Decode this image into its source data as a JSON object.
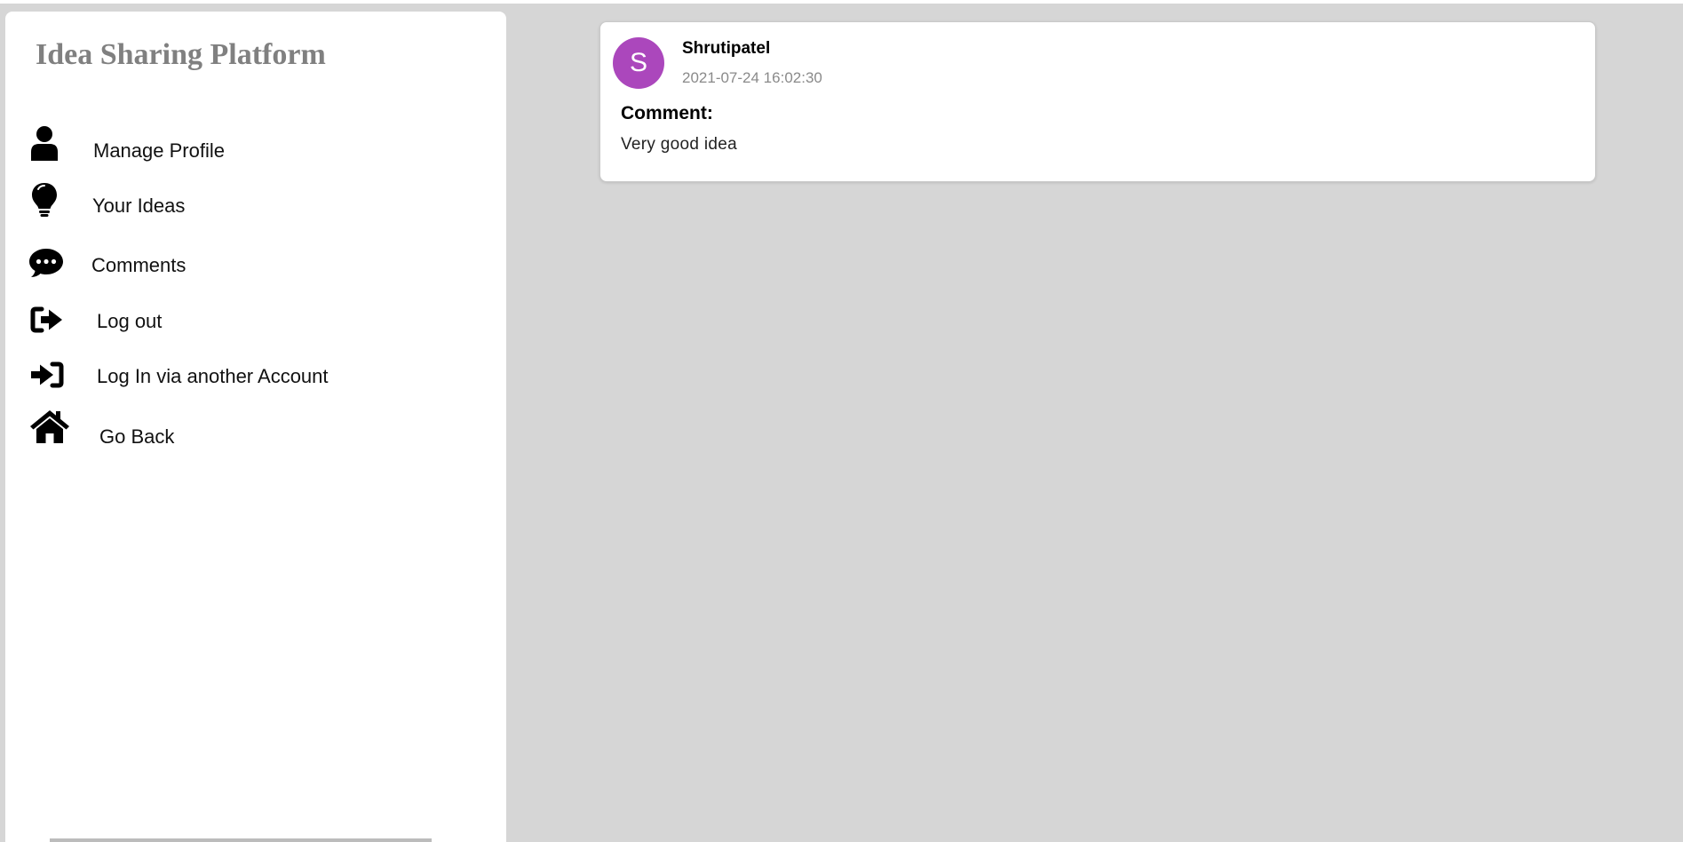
{
  "sidebar": {
    "brand_title": "Idea Sharing Platform",
    "items": [
      {
        "label": "Manage Profile",
        "icon": "user-icon"
      },
      {
        "label": "Your Ideas",
        "icon": "lightbulb-icon"
      },
      {
        "label": "Comments",
        "icon": "comment-dots-icon"
      },
      {
        "label": "Log out",
        "icon": "sign-out-icon"
      },
      {
        "label": "Log In via another Account",
        "icon": "sign-in-icon"
      },
      {
        "label": "Go Back",
        "icon": "home-icon"
      }
    ]
  },
  "main": {
    "comments": [
      {
        "avatar_letter": "S",
        "avatar_color": "#ab47bc",
        "username": "Shrutipatel",
        "timestamp": "2021-07-24 16:02:30",
        "heading": "Comment:",
        "text": "Very good idea"
      }
    ]
  }
}
